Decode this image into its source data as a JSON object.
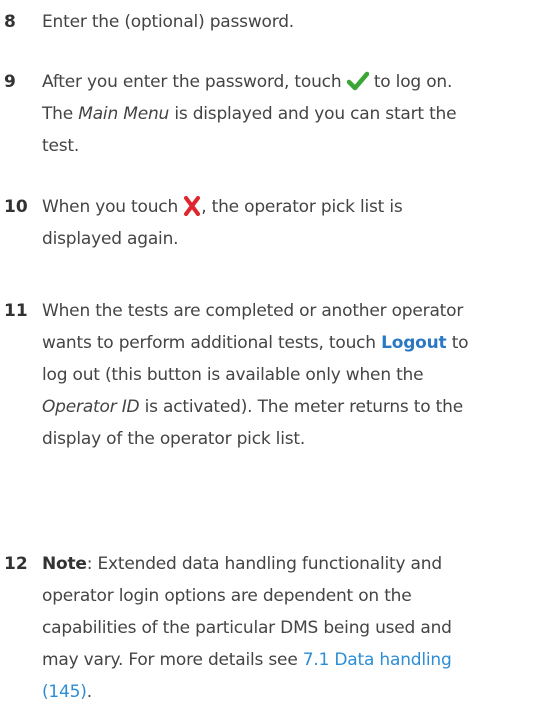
{
  "steps": [
    {
      "number": "8",
      "line1": "Enter the (optional) password."
    },
    {
      "number": "9",
      "line1_a": "After you enter the password, touch ",
      "line1_b": " to log on.",
      "line2_a": "The ",
      "line2_italic": "Main Menu",
      "line2_b": " is displayed and you can start the",
      "line3": "test.",
      "icon": "checkmark-icon",
      "icon_color": "#3aa635"
    },
    {
      "number": "10",
      "line1_a": "When you touch ",
      "line1_b": ", the operator pick list is",
      "line2": "displayed again.",
      "icon": "cross-icon",
      "icon_color": "#e0252e"
    },
    {
      "number": "11",
      "line1": "When the tests are completed or another operator",
      "line2_a": "wants to perform additional tests, touch ",
      "line2_bold": "Logout",
      "line2_b": " to",
      "line3": "log out (this button is available only when the",
      "line4_italic": "Operator ID",
      "line4_b": " is activated). The meter returns to the",
      "line5": "display of the operator pick list."
    },
    {
      "number": "12",
      "line1_bold": "Note",
      "line1_b": ": Extended data handling functionality and",
      "line2": "operator login options are dependent on the",
      "line3": "capabilities of the particular DMS being used and",
      "line4_a": "may vary. For more details see ",
      "line4_link": "7.1 Data handling",
      "line5_link": "(145)",
      "line5_b": "."
    }
  ],
  "colors": {
    "accent_blue": "#2b79c2",
    "link_blue": "#2b8ed6",
    "check_green": "#3aa635",
    "cross_red": "#e0252e"
  }
}
